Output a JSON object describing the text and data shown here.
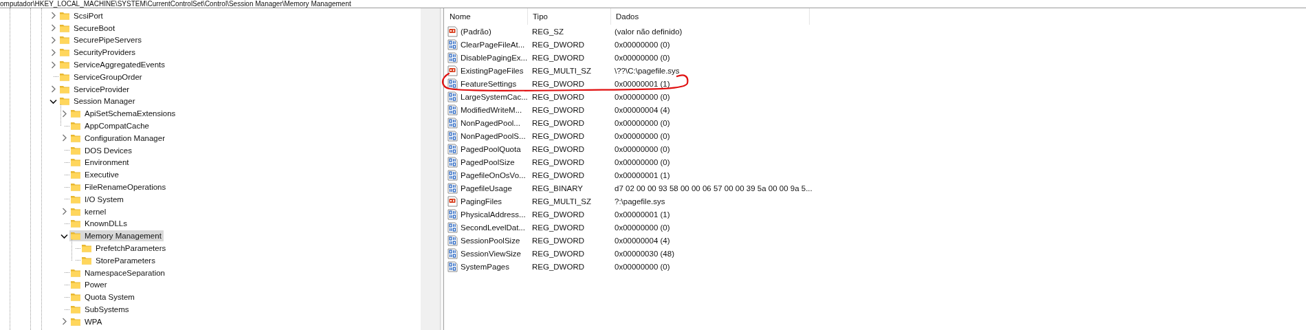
{
  "address_bar": {
    "path": "omputador\\HKEY_LOCAL_MACHINE\\SYSTEM\\CurrentControlSet\\Control\\Session Manager\\Memory Management"
  },
  "tree": [
    {
      "label": "ScsiPort",
      "kind": "branch",
      "expanded": false,
      "selected": false
    },
    {
      "label": "SecureBoot",
      "kind": "branch",
      "expanded": false,
      "selected": false
    },
    {
      "label": "SecurePipeServers",
      "kind": "branch",
      "expanded": false,
      "selected": false
    },
    {
      "label": "SecurityProviders",
      "kind": "branch",
      "expanded": false,
      "selected": false
    },
    {
      "label": "ServiceAggregatedEvents",
      "kind": "branch",
      "expanded": false,
      "selected": false
    },
    {
      "label": "ServiceGroupOrder",
      "kind": "leaf",
      "selected": false
    },
    {
      "label": "ServiceProvider",
      "kind": "branch",
      "expanded": false,
      "selected": false
    },
    {
      "label": "Session Manager",
      "kind": "branch",
      "expanded": true,
      "selected": false,
      "children": [
        {
          "label": "ApiSetSchemaExtensions",
          "kind": "branch",
          "expanded": false,
          "selected": false
        },
        {
          "label": "AppCompatCache",
          "kind": "leaf",
          "selected": false
        },
        {
          "label": "Configuration Manager",
          "kind": "branch",
          "expanded": false,
          "selected": false
        },
        {
          "label": "DOS Devices",
          "kind": "leaf",
          "selected": false
        },
        {
          "label": "Environment",
          "kind": "leaf",
          "selected": false
        },
        {
          "label": "Executive",
          "kind": "leaf",
          "selected": false
        },
        {
          "label": "FileRenameOperations",
          "kind": "leaf",
          "selected": false
        },
        {
          "label": "I/O System",
          "kind": "leaf",
          "selected": false
        },
        {
          "label": "kernel",
          "kind": "branch",
          "expanded": false,
          "selected": false
        },
        {
          "label": "KnownDLLs",
          "kind": "leaf",
          "selected": false
        },
        {
          "label": "Memory Management",
          "kind": "branch",
          "expanded": true,
          "selected": true,
          "children": [
            {
              "label": "PrefetchParameters",
              "kind": "leaf",
              "selected": false
            },
            {
              "label": "StoreParameters",
              "kind": "leaf",
              "selected": false
            }
          ]
        },
        {
          "label": "NamespaceSeparation",
          "kind": "leaf",
          "selected": false
        },
        {
          "label": "Power",
          "kind": "leaf",
          "selected": false
        },
        {
          "label": "Quota System",
          "kind": "leaf",
          "selected": false
        },
        {
          "label": "SubSystems",
          "kind": "leaf",
          "selected": false
        },
        {
          "label": "WPA",
          "kind": "branch",
          "expanded": false,
          "selected": false
        }
      ]
    }
  ],
  "values_table": {
    "columns": [
      "Nome",
      "Tipo",
      "Dados"
    ],
    "rows": [
      {
        "kind": "string",
        "name": "(Padrão)",
        "type": "REG_SZ",
        "data": "(valor não definido)",
        "circled": false
      },
      {
        "kind": "number",
        "name": "ClearPageFileAt...",
        "type": "REG_DWORD",
        "data": "0x00000000 (0)",
        "circled": false
      },
      {
        "kind": "number",
        "name": "DisablePagingEx...",
        "type": "REG_DWORD",
        "data": "0x00000000 (0)",
        "circled": false
      },
      {
        "kind": "string",
        "name": "ExistingPageFiles",
        "type": "REG_MULTI_SZ",
        "data": "\\??\\C:\\pagefile.sys",
        "circled": false
      },
      {
        "kind": "number",
        "name": "FeatureSettings",
        "type": "REG_DWORD",
        "data": "0x00000001 (1)",
        "circled": true
      },
      {
        "kind": "number",
        "name": "LargeSystemCac...",
        "type": "REG_DWORD",
        "data": "0x00000000 (0)",
        "circled": false
      },
      {
        "kind": "number",
        "name": "ModifiedWriteM...",
        "type": "REG_DWORD",
        "data": "0x00000004 (4)",
        "circled": false
      },
      {
        "kind": "number",
        "name": "NonPagedPool...",
        "type": "REG_DWORD",
        "data": "0x00000000 (0)",
        "circled": false
      },
      {
        "kind": "number",
        "name": "NonPagedPoolS...",
        "type": "REG_DWORD",
        "data": "0x00000000 (0)",
        "circled": false
      },
      {
        "kind": "number",
        "name": "PagedPoolQuota",
        "type": "REG_DWORD",
        "data": "0x00000000 (0)",
        "circled": false
      },
      {
        "kind": "number",
        "name": "PagedPoolSize",
        "type": "REG_DWORD",
        "data": "0x00000000 (0)",
        "circled": false
      },
      {
        "kind": "number",
        "name": "PagefileOnOsVo...",
        "type": "REG_DWORD",
        "data": "0x00000001 (1)",
        "circled": false
      },
      {
        "kind": "number",
        "name": "PagefileUsage",
        "type": "REG_BINARY",
        "data": "d7 02 00 00 93 58 00 00 06 57 00 00 39 5a 00 00 9a 5...",
        "circled": false
      },
      {
        "kind": "string",
        "name": "PagingFiles",
        "type": "REG_MULTI_SZ",
        "data": "?:\\pagefile.sys",
        "circled": false
      },
      {
        "kind": "number",
        "name": "PhysicalAddress...",
        "type": "REG_DWORD",
        "data": "0x00000001 (1)",
        "circled": false
      },
      {
        "kind": "number",
        "name": "SecondLevelDat...",
        "type": "REG_DWORD",
        "data": "0x00000000 (0)",
        "circled": false
      },
      {
        "kind": "number",
        "name": "SessionPoolSize",
        "type": "REG_DWORD",
        "data": "0x00000004 (4)",
        "circled": false
      },
      {
        "kind": "number",
        "name": "SessionViewSize",
        "type": "REG_DWORD",
        "data": "0x00000030 (48)",
        "circled": false
      },
      {
        "kind": "number",
        "name": "SystemPages",
        "type": "REG_DWORD",
        "data": "0x00000000 (0)",
        "circled": false
      }
    ]
  }
}
